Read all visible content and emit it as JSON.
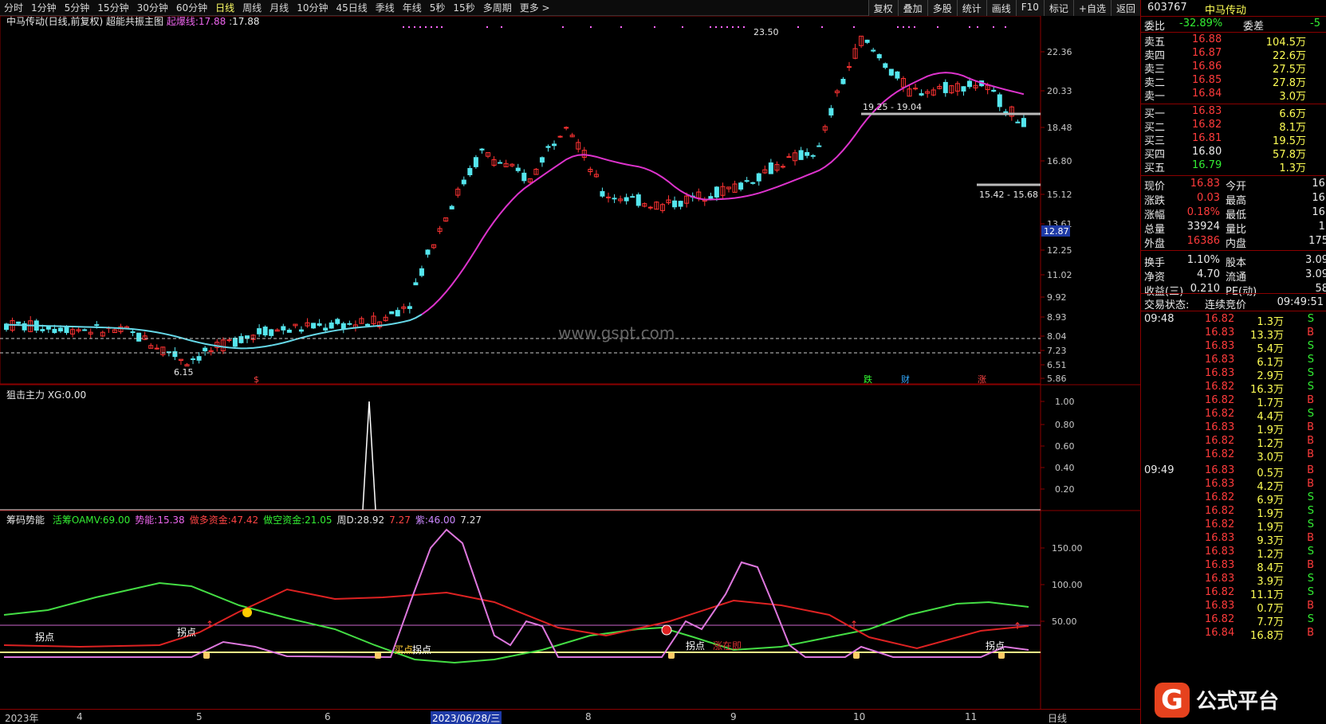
{
  "toolbar": {
    "tabs": [
      "分时",
      "1分钟",
      "5分钟",
      "15分钟",
      "30分钟",
      "60分钟",
      "日线",
      "周线",
      "月线",
      "10分钟",
      "45日线",
      "季线",
      "年线",
      "5秒",
      "15秒",
      "多周期",
      "更多 >"
    ],
    "active": 6,
    "right_buttons": [
      "复权",
      "叠加",
      "多股",
      "统计",
      "画线",
      "F10",
      "标记",
      "+自选",
      "返回"
    ]
  },
  "main_panel": {
    "stock": "中马传动(日线,前复权)",
    "indicator": "超能共振主图",
    "line_label": "起爆线:",
    "line_v1": "17.88",
    "line_v2": "17.88",
    "yticks": [
      "22.36",
      "20.33",
      "18.48",
      "16.80",
      "15.12",
      "13.61",
      "12.25",
      "11.02",
      "9.92",
      "8.93",
      "8.04",
      "7.23",
      "6.51",
      "5.86"
    ],
    "price_tag": "12.87",
    "high_label": "23.50",
    "low_label": "6.15",
    "range1": "19.25 - 19.04",
    "range2": "15.42 - 15.68",
    "watermark": "www.gspt.com",
    "markers": [
      {
        "t": "$",
        "color": "#ff4444"
      },
      {
        "t": "跌",
        "color": "#33ff33"
      },
      {
        "t": "财",
        "color": "#33aaff"
      },
      {
        "t": "涨",
        "color": "#ff4444"
      }
    ]
  },
  "mid_panel": {
    "title": "狙击主力",
    "xg_label": "XG:",
    "xg_value": "0.00",
    "yticks": [
      "1.00",
      "0.80",
      "0.60",
      "0.40",
      "0.20"
    ]
  },
  "bottom_panel": {
    "title": "筹码势能",
    "items": [
      {
        "label": "活筹OAMV:",
        "value": "69.00",
        "color": "#33ee33"
      },
      {
        "label": "势能:",
        "value": "15.38",
        "color": "#ee66ee"
      },
      {
        "label": "做多资金:",
        "value": "47.42",
        "color": "#ff4444"
      },
      {
        "label": "做空资金:",
        "value": "21.05",
        "color": "#33ee33"
      },
      {
        "label": "周D:",
        "value": "28.92",
        "color": "#e0e0e0"
      },
      {
        "label": "",
        "value": "7.27",
        "color": "#ff4444"
      },
      {
        "label": "紫:",
        "value": "46.00",
        "color": "#cc88ff"
      },
      {
        "label": "",
        "value": "7.27",
        "color": "#e0e0e0"
      }
    ],
    "yticks": [
      "150.00",
      "100.00",
      "50.00"
    ],
    "labels": [
      "拐点",
      "拐点",
      "拐点",
      "拐点",
      "拐点"
    ],
    "label_extra": [
      "买点",
      "涨在即"
    ]
  },
  "xaxis": {
    "labels": [
      "2023年",
      "4",
      "5",
      "6",
      "2023/06/28/三",
      "8",
      "9",
      "10",
      "11"
    ],
    "period": "日线"
  },
  "quote": {
    "code": "603767",
    "name": "中马传动",
    "weibi_label": "委比",
    "weibi": "-32.89%",
    "weicha_label": "委差",
    "weicha": "-5",
    "asks": [
      {
        "l": "卖五",
        "p": "16.88",
        "v": "104.5万"
      },
      {
        "l": "卖四",
        "p": "16.87",
        "v": "22.6万"
      },
      {
        "l": "卖三",
        "p": "16.86",
        "v": "27.5万"
      },
      {
        "l": "卖二",
        "p": "16.85",
        "v": "27.8万"
      },
      {
        "l": "卖一",
        "p": "16.84",
        "v": "3.0万"
      }
    ],
    "bids": [
      {
        "l": "买一",
        "p": "16.83",
        "v": "6.6万"
      },
      {
        "l": "买二",
        "p": "16.82",
        "v": "8.1万"
      },
      {
        "l": "买三",
        "p": "16.81",
        "v": "19.5万"
      },
      {
        "l": "买四",
        "p": "16.80",
        "v": "57.8万"
      },
      {
        "l": "买五",
        "p": "16.79",
        "v": "1.3万"
      }
    ],
    "stats": [
      {
        "l1": "现价",
        "v1": "16.83",
        "c1": "red",
        "l2": "今开",
        "v2": "16."
      },
      {
        "l1": "涨跌",
        "v1": "0.03",
        "c1": "red",
        "l2": "最高",
        "v2": "16."
      },
      {
        "l1": "涨幅",
        "v1": "0.18%",
        "c1": "red",
        "l2": "最低",
        "v2": "16."
      },
      {
        "l1": "总量",
        "v1": "33924",
        "c1": "white",
        "l2": "量比",
        "v2": "1."
      },
      {
        "l1": "外盘",
        "v1": "16386",
        "c1": "red",
        "l2": "内盘",
        "v2": "175"
      },
      {
        "l1": "换手",
        "v1": "1.10%",
        "c1": "white",
        "l2": "股本",
        "v2": "3.09"
      },
      {
        "l1": "净资",
        "v1": "4.70",
        "c1": "white",
        "l2": "流通",
        "v2": "3.09"
      },
      {
        "l1": "收益(三)",
        "v1": "0.210",
        "c1": "white",
        "l2": "PE(动)",
        "v2": "58"
      }
    ],
    "status_label": "交易状态:",
    "status": "连续竞价",
    "status_time": "09:49:51",
    "ticks": [
      {
        "t": "09:48",
        "p": "16.82",
        "v": "1.3万",
        "s": "S"
      },
      {
        "t": "",
        "p": "16.83",
        "v": "13.3万",
        "s": "B"
      },
      {
        "t": "",
        "p": "16.83",
        "v": "5.4万",
        "s": "S"
      },
      {
        "t": "",
        "p": "16.83",
        "v": "6.1万",
        "s": "S"
      },
      {
        "t": "",
        "p": "16.83",
        "v": "2.9万",
        "s": "S"
      },
      {
        "t": "",
        "p": "16.82",
        "v": "16.3万",
        "s": "S"
      },
      {
        "t": "",
        "p": "16.82",
        "v": "1.7万",
        "s": "B"
      },
      {
        "t": "",
        "p": "16.82",
        "v": "4.4万",
        "s": "S"
      },
      {
        "t": "",
        "p": "16.83",
        "v": "1.9万",
        "s": "B"
      },
      {
        "t": "",
        "p": "16.82",
        "v": "1.2万",
        "s": "B"
      },
      {
        "t": "",
        "p": "16.82",
        "v": "3.0万",
        "s": "B"
      },
      {
        "t": "09:49",
        "p": "16.83",
        "v": "0.5万",
        "s": "B"
      },
      {
        "t": "",
        "p": "16.83",
        "v": "4.2万",
        "s": "B"
      },
      {
        "t": "",
        "p": "16.82",
        "v": "6.9万",
        "s": "S"
      },
      {
        "t": "",
        "p": "16.82",
        "v": "1.9万",
        "s": "S"
      },
      {
        "t": "",
        "p": "16.82",
        "v": "1.9万",
        "s": "S"
      },
      {
        "t": "",
        "p": "16.83",
        "v": "9.3万",
        "s": "B"
      },
      {
        "t": "",
        "p": "16.83",
        "v": "1.2万",
        "s": "S"
      },
      {
        "t": "",
        "p": "16.83",
        "v": "8.4万",
        "s": "B"
      },
      {
        "t": "",
        "p": "16.83",
        "v": "3.9万",
        "s": "S"
      },
      {
        "t": "",
        "p": "16.82",
        "v": "11.1万",
        "s": "S"
      },
      {
        "t": "",
        "p": "16.83",
        "v": "0.7万",
        "s": "B"
      },
      {
        "t": "",
        "p": "16.82",
        "v": "7.7万",
        "s": "S"
      },
      {
        "t": "",
        "p": "16.84",
        "v": "16.8万",
        "s": "B"
      }
    ]
  },
  "logo": {
    "mark": "G",
    "text": "公式平台"
  }
}
